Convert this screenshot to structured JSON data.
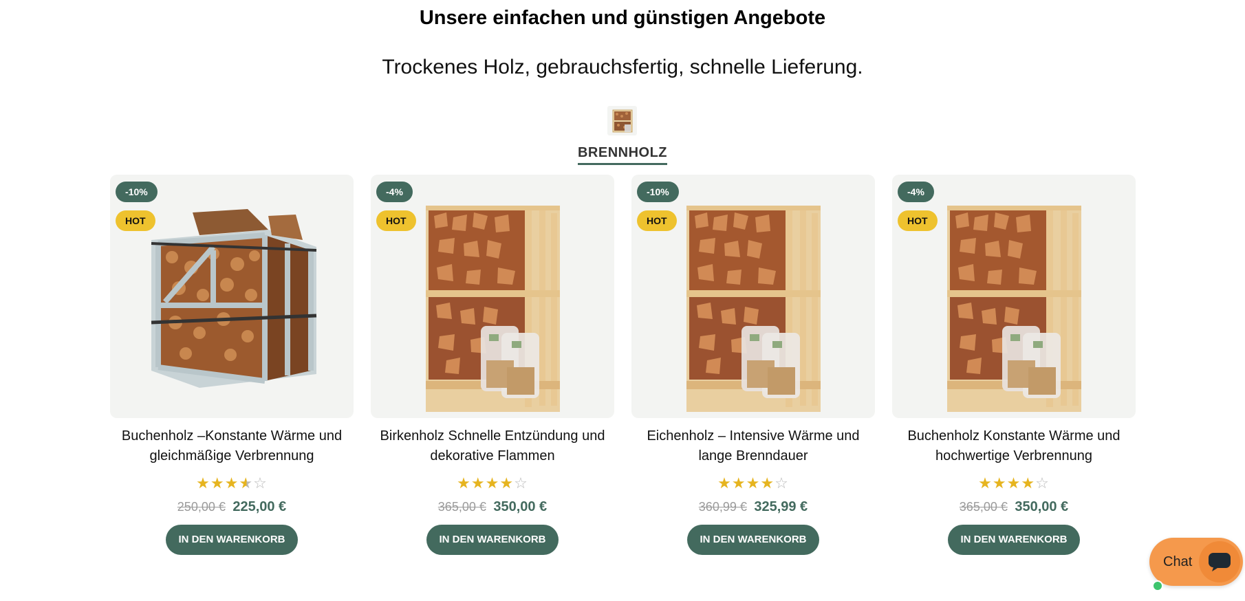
{
  "section": {
    "heading": "Unsere einfachen und günstigen Angebote",
    "subheading": "Trockenes Holz, gebrauchsfertig, schnelle Lieferung."
  },
  "category": {
    "label": "BRENNHOLZ",
    "icon": "firewood-thumbnail"
  },
  "products": [
    {
      "discount": "-10%",
      "tag": "HOT",
      "title": "Buchenholz –Konstante Wärme und gleichmäßige Verbrennung",
      "rating": 3.5,
      "rating_max": 5,
      "old_price": "250,00 €",
      "price": "225,00 €",
      "cta": "IN DEN WARENKORB",
      "image": "firewood-crate"
    },
    {
      "discount": "-4%",
      "tag": "HOT",
      "title": "Birkenholz Schnelle Entzündung und dekorative Flammen",
      "rating": 4,
      "rating_max": 5,
      "old_price": "365,00 €",
      "price": "350,00 €",
      "cta": "IN DEN WARENKORB",
      "image": "firewood-pallet-with-kindling"
    },
    {
      "discount": "-10%",
      "tag": "HOT",
      "title": "Eichenholz – Intensive Wärme und lange Brenndauer",
      "rating": 4,
      "rating_max": 5,
      "old_price": "360,99 €",
      "price": "325,99 €",
      "cta": "IN DEN WARENKORB",
      "image": "firewood-pallet-with-kindling"
    },
    {
      "discount": "-4%",
      "tag": "HOT",
      "title": "Buchenholz Konstante Wärme und hochwertige Verbrennung",
      "rating": 4,
      "rating_max": 5,
      "old_price": "365,00 €",
      "price": "350,00 €",
      "cta": "IN DEN WARENKORB",
      "image": "firewood-pallet-with-kindling"
    }
  ],
  "chat": {
    "label": "Chat",
    "icon": "chat-bubble-icon",
    "status": "online"
  },
  "colors": {
    "accent": "#436a5e",
    "hot_badge": "#eec22e",
    "star": "#e6b41f",
    "chat": "#f5994c"
  }
}
